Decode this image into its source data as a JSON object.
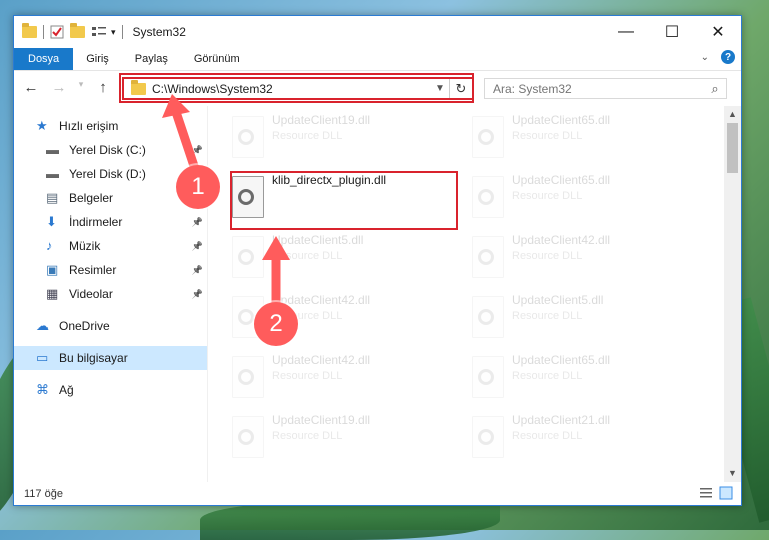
{
  "window": {
    "title": "System32",
    "controls": {
      "minimize": "—",
      "maximize": "☐",
      "close": "✕"
    }
  },
  "ribbon": {
    "tabs": [
      "Dosya",
      "Giriş",
      "Paylaş",
      "Görünüm"
    ],
    "help": "?"
  },
  "navigation": {
    "back": "←",
    "forward": "→",
    "up": "↑",
    "address": "C:\\Windows\\System32",
    "search_placeholder": "Ara: System32"
  },
  "sidebar": {
    "items": [
      {
        "label": "Hızlı erişim",
        "icon": "star-icon",
        "pinned": false
      },
      {
        "label": "Yerel Disk (C:)",
        "icon": "drive-icon",
        "pinned": true
      },
      {
        "label": "Yerel Disk (D:)",
        "icon": "drive-icon",
        "pinned": true
      },
      {
        "label": "Belgeler",
        "icon": "documents-icon",
        "pinned": true
      },
      {
        "label": "İndirmeler",
        "icon": "download-icon",
        "pinned": true
      },
      {
        "label": "Müzik",
        "icon": "music-icon",
        "pinned": true
      },
      {
        "label": "Resimler",
        "icon": "pictures-icon",
        "pinned": true
      },
      {
        "label": "Videolar",
        "icon": "video-icon",
        "pinned": true
      },
      {
        "label": "OneDrive",
        "icon": "cloud-icon",
        "pinned": false
      },
      {
        "label": "Bu bilgisayar",
        "icon": "computer-icon",
        "pinned": false
      },
      {
        "label": "Ağ",
        "icon": "network-icon",
        "pinned": false
      }
    ]
  },
  "files": [
    {
      "name": "UpdateClient19.dll",
      "type": "Resource DLL"
    },
    {
      "name": "UpdateClient65.dll",
      "type": "Resource DLL"
    },
    {
      "name": "klib_directx_plugin.dll",
      "type": ""
    },
    {
      "name": "UpdateClient65.dll",
      "type": "Resource DLL"
    },
    {
      "name": "UpdateClient5.dll",
      "type": "Resource DLL"
    },
    {
      "name": "UpdateClient42.dll",
      "type": "Resource DLL"
    },
    {
      "name": "UpdateClient42.dll",
      "type": "Resource DLL"
    },
    {
      "name": "UpdateClient5.dll",
      "type": "Resource DLL"
    },
    {
      "name": "UpdateClient42.dll",
      "type": "Resource DLL"
    },
    {
      "name": "UpdateClient65.dll",
      "type": "Resource DLL"
    },
    {
      "name": "UpdateClient19.dll",
      "type": "Resource DLL"
    },
    {
      "name": "UpdateClient21.dll",
      "type": "Resource DLL"
    }
  ],
  "status": {
    "item_count": "117 öğe"
  },
  "annotations": {
    "step1": "1",
    "step2": "2",
    "color": "#ff5c5c"
  }
}
